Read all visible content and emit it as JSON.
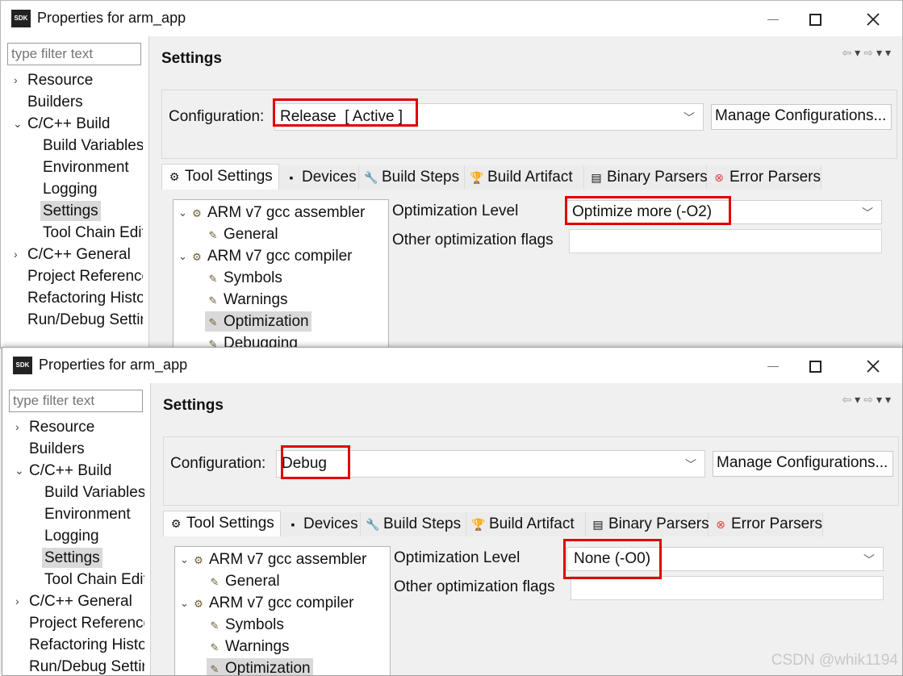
{
  "windows": [
    {
      "title": "Properties for arm_app",
      "icon_text": "SDK",
      "filter_placeholder": "type filter text",
      "nav": [
        {
          "label": "Resource",
          "twisty": ">"
        },
        {
          "label": "Builders",
          "twisty": ""
        },
        {
          "label": "C/C++ Build",
          "twisty": "v"
        },
        {
          "label": "Build Variables",
          "twisty": ""
        },
        {
          "label": "Environment",
          "twisty": ""
        },
        {
          "label": "Logging",
          "twisty": ""
        },
        {
          "label": "Settings",
          "twisty": "",
          "selected": true
        },
        {
          "label": "Tool Chain Editor",
          "twisty": ""
        },
        {
          "label": "C/C++ General",
          "twisty": ">"
        },
        {
          "label": "Project References",
          "twisty": ""
        },
        {
          "label": "Refactoring History",
          "twisty": ""
        },
        {
          "label": "Run/Debug Settings",
          "twisty": ""
        }
      ],
      "page_title": "Settings",
      "configuration_label": "Configuration:",
      "configuration_value": "Release  [ Active ]",
      "manage_button": "Manage Configurations...",
      "tabs": [
        "Tool Settings",
        "Devices",
        "Build Steps",
        "Build Artifact",
        "Binary Parsers",
        "Error Parsers"
      ],
      "tool_tree": [
        {
          "label": "ARM v7 gcc assembler",
          "twisty": "v"
        },
        {
          "label": "General"
        },
        {
          "label": "ARM v7 gcc compiler",
          "twisty": "v"
        },
        {
          "label": "Symbols"
        },
        {
          "label": "Warnings"
        },
        {
          "label": "Optimization",
          "selected": true
        },
        {
          "label": "Debugging"
        }
      ],
      "optimization_level_label": "Optimization Level",
      "optimization_level_value": "Optimize more (-O2)",
      "other_flags_label": "Other optimization flags",
      "other_flags_value": ""
    },
    {
      "title": "Properties for arm_app",
      "icon_text": "SDK",
      "filter_placeholder": "type filter text",
      "nav": [
        {
          "label": "Resource",
          "twisty": ">"
        },
        {
          "label": "Builders",
          "twisty": ""
        },
        {
          "label": "C/C++ Build",
          "twisty": "v"
        },
        {
          "label": "Build Variables",
          "twisty": ""
        },
        {
          "label": "Environment",
          "twisty": ""
        },
        {
          "label": "Logging",
          "twisty": ""
        },
        {
          "label": "Settings",
          "twisty": "",
          "selected": true
        },
        {
          "label": "Tool Chain Editor",
          "twisty": ""
        },
        {
          "label": "C/C++ General",
          "twisty": ">"
        },
        {
          "label": "Project References",
          "twisty": ""
        },
        {
          "label": "Refactoring History",
          "twisty": ""
        },
        {
          "label": "Run/Debug Settings",
          "twisty": ""
        }
      ],
      "page_title": "Settings",
      "configuration_label": "Configuration:",
      "configuration_value": "Debug",
      "manage_button": "Manage Configurations...",
      "tabs": [
        "Tool Settings",
        "Devices",
        "Build Steps",
        "Build Artifact",
        "Binary Parsers",
        "Error Parsers"
      ],
      "tool_tree": [
        {
          "label": "ARM v7 gcc assembler",
          "twisty": "v"
        },
        {
          "label": "General"
        },
        {
          "label": "ARM v7 gcc compiler",
          "twisty": "v"
        },
        {
          "label": "Symbols"
        },
        {
          "label": "Warnings"
        },
        {
          "label": "Optimization",
          "selected": true
        }
      ],
      "optimization_level_label": "Optimization Level",
      "optimization_level_value": "None (-O0)",
      "other_flags_label": "Other optimization flags",
      "other_flags_value": ""
    }
  ],
  "watermark": "CSDN @whik1194",
  "highlight_color": "#e00000"
}
